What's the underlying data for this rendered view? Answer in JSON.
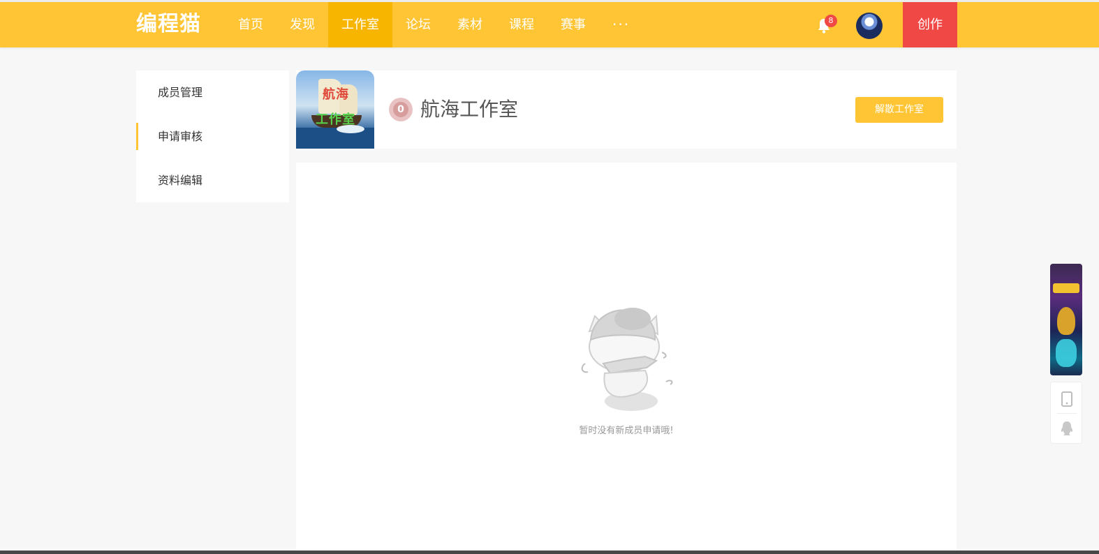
{
  "brand": {
    "logo_text": "编程猫"
  },
  "nav": {
    "items": [
      {
        "label": "首页"
      },
      {
        "label": "发现"
      },
      {
        "label": "工作室"
      },
      {
        "label": "论坛"
      },
      {
        "label": "素材"
      },
      {
        "label": "课程"
      },
      {
        "label": "赛事"
      }
    ],
    "active": "工作室",
    "more_label": "···",
    "notification_count": "8",
    "create_label": "创作"
  },
  "sidebar": {
    "items": [
      {
        "label": "成员管理"
      },
      {
        "label": "申请审核"
      },
      {
        "label": "资料编辑"
      }
    ],
    "active": "申请审核"
  },
  "studio": {
    "cover_text_line1": "航海",
    "cover_text_line2": "工作室",
    "level": "0",
    "name": "航海工作室",
    "dissolve_label": "解散工作室"
  },
  "content": {
    "empty_message": "暂时没有新成员申请哦!"
  },
  "colors": {
    "brand_yellow": "#ffc535",
    "nav_active": "#f7b500",
    "create_red": "#f04844",
    "page_bg": "#f7f7f7"
  },
  "icons": {
    "notification": "bell-icon",
    "phone": "phone-icon",
    "qq": "qq-penguin-icon"
  }
}
